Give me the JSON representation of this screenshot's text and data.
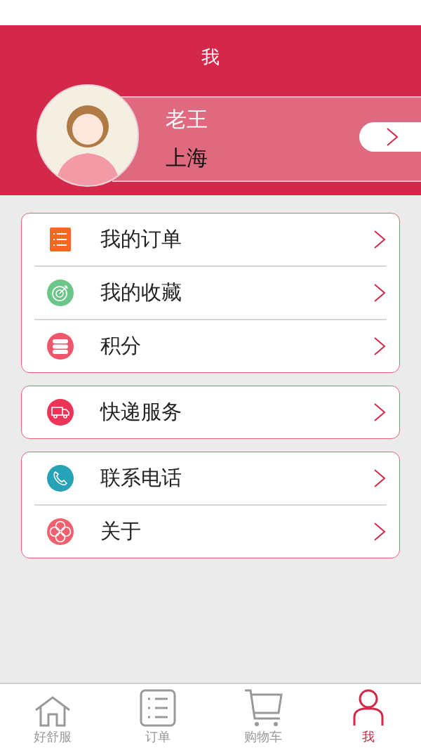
{
  "header": {
    "title": "我"
  },
  "profile": {
    "name": "老王",
    "city": "上海"
  },
  "menu_groups": [
    {
      "items": [
        {
          "label": "我的订单",
          "kind": "orders"
        },
        {
          "label": "我的收藏",
          "kind": "favorites"
        },
        {
          "label": "积分",
          "kind": "points"
        }
      ]
    },
    {
      "items": [
        {
          "label": "快递服务",
          "kind": "delivery"
        }
      ]
    },
    {
      "items": [
        {
          "label": "联系电话",
          "kind": "phone"
        },
        {
          "label": "关于",
          "kind": "about"
        }
      ]
    }
  ],
  "tab_bar": [
    {
      "label": "好舒服",
      "kind": "home",
      "selected": false
    },
    {
      "label": "订单",
      "kind": "list",
      "selected": false
    },
    {
      "label": "购物车",
      "kind": "cart",
      "selected": false
    },
    {
      "label": "我",
      "kind": "user",
      "selected": true
    }
  ]
}
